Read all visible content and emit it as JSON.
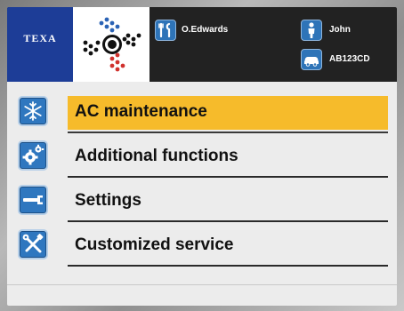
{
  "header": {
    "brand": "TEXA",
    "technician": "O.Edwards",
    "customer": "John",
    "plate": "AB123CD"
  },
  "icons": {
    "technician": "technician-tools-icon",
    "customer": "person-icon",
    "vehicle": "car-icon",
    "ac_maintenance": "snowflake-icon",
    "additional_functions": "gears-icon",
    "settings": "wrench-icon",
    "customized_service": "tools-icon"
  },
  "menu": {
    "items": [
      {
        "label": "AC maintenance",
        "selected": true
      },
      {
        "label": "Additional functions",
        "selected": false
      },
      {
        "label": "Settings",
        "selected": false
      },
      {
        "label": "Customized service",
        "selected": false
      }
    ]
  },
  "colors": {
    "brand_blue": "#1d3d97",
    "icon_blue": "#2f77bf",
    "selection": "#f6bb2b",
    "header_bg": "#222222",
    "screen_bg": "#ececec"
  }
}
